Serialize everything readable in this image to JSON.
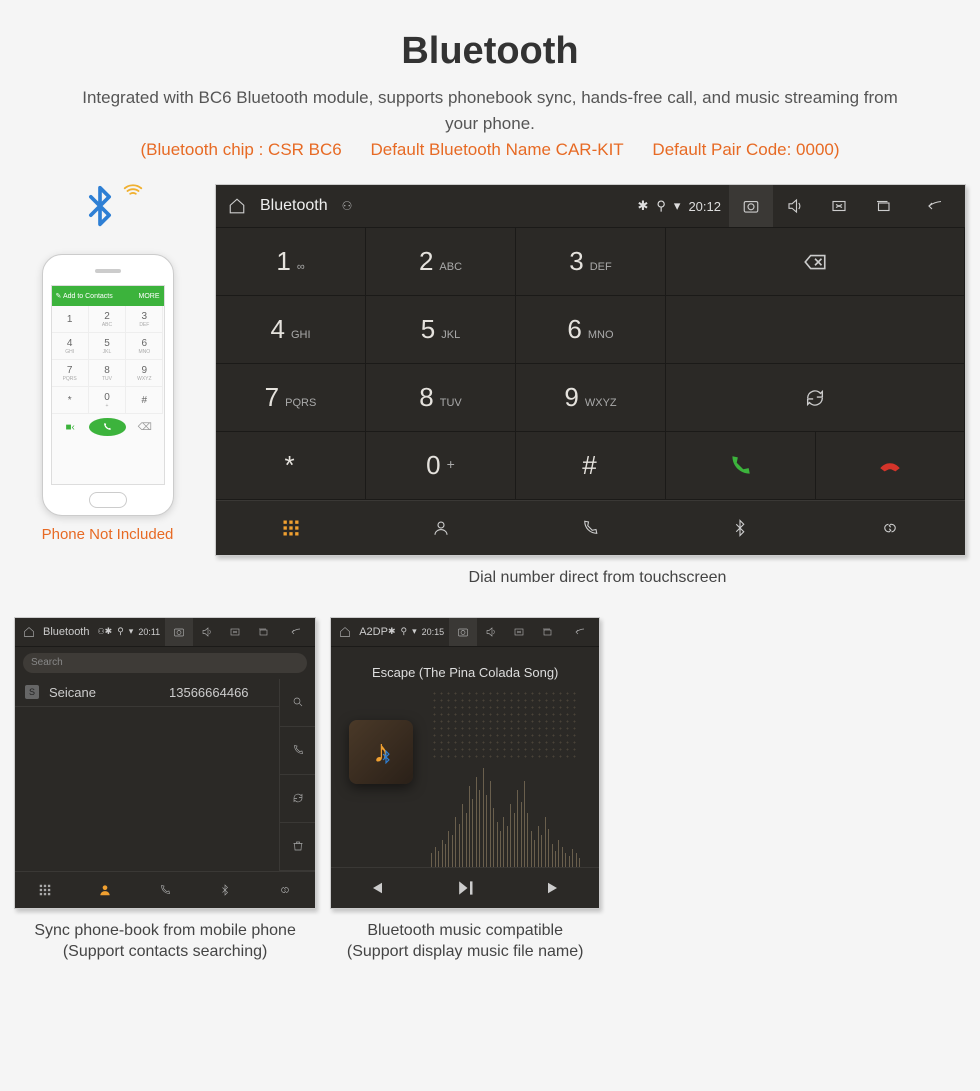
{
  "title": "Bluetooth",
  "subtitle": "Integrated with BC6 Bluetooth module, supports phonebook sync, hands-free call, and music streaming from your phone.",
  "spec": {
    "chip": "(Bluetooth chip : CSR BC6",
    "name": "Default Bluetooth Name CAR-KIT",
    "code": "Default Pair Code: 0000)"
  },
  "phone_not_included": "Phone Not Included",
  "phone_screen": {
    "top_label": "Add to Contacts",
    "top_right": "MORE",
    "keys": [
      "1",
      "2",
      "3",
      "4",
      "5",
      "6",
      "7",
      "8",
      "9",
      "*",
      "0",
      "#"
    ],
    "subs": [
      "",
      "ABC",
      "DEF",
      "GHI",
      "JKL",
      "MNO",
      "PQRS",
      "TUV",
      "WXYZ",
      "",
      "+",
      ""
    ]
  },
  "headunit": {
    "app_title": "Bluetooth",
    "time": "20:12",
    "keys": [
      {
        "num": "1",
        "sub": "∞"
      },
      {
        "num": "2",
        "sub": "ABC"
      },
      {
        "num": "3",
        "sub": "DEF"
      },
      {
        "num": "4",
        "sub": "GHI"
      },
      {
        "num": "5",
        "sub": "JKL"
      },
      {
        "num": "6",
        "sub": "MNO"
      },
      {
        "num": "7",
        "sub": "PQRS"
      },
      {
        "num": "8",
        "sub": "TUV"
      },
      {
        "num": "9",
        "sub": "WXYZ"
      },
      {
        "num": "*",
        "sub": ""
      },
      {
        "num": "0",
        "sub": "+"
      },
      {
        "num": "#",
        "sub": ""
      }
    ]
  },
  "caption_dial": "Dial number direct from touchscreen",
  "contacts": {
    "app_title": "Bluetooth",
    "time": "20:11",
    "search": "Search",
    "list": [
      {
        "badge": "S",
        "name": "Seicane",
        "number": "13566664466"
      }
    ]
  },
  "caption_contacts_1": "Sync phone-book from mobile phone",
  "caption_contacts_2": "(Support contacts searching)",
  "music": {
    "app_title": "A2DP",
    "time": "20:15",
    "song": "Escape (The Pina Colada Song)"
  },
  "caption_music_1": "Bluetooth music compatible",
  "caption_music_2": "(Support display music file name)"
}
